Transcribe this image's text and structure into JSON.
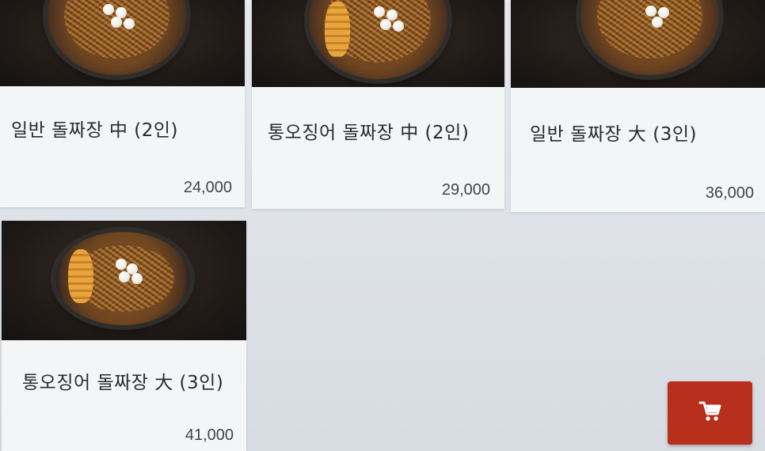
{
  "menu": {
    "items": [
      {
        "name": "일반 돌짜장 中 (2인)",
        "price": "24,000"
      },
      {
        "name": "통오징어 돌짜장 中 (2인)",
        "price": "29,000"
      },
      {
        "name": "일반 돌짜장 大 (3인)",
        "price": "36,000"
      },
      {
        "name": "통오징어 돌짜장 大 (3인)",
        "price": "41,000"
      }
    ]
  },
  "cart": {
    "icon": "shopping-cart-icon",
    "color": "#b8301c"
  }
}
